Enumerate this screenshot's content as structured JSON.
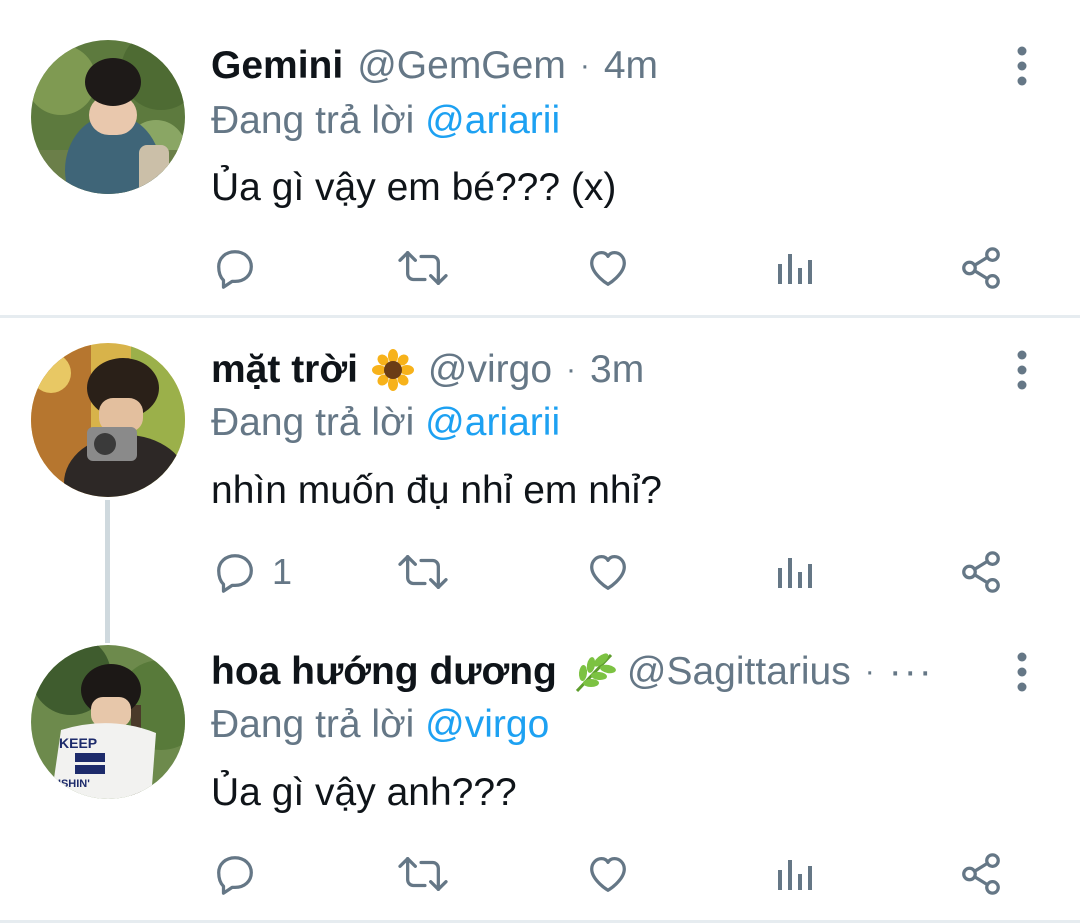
{
  "tweets": [
    {
      "name": "Gemini",
      "emoji": "",
      "handle": "@GemGem",
      "dot": "·",
      "time": "4m",
      "replying_prefix": "Đang trả lời ",
      "replying_to": "@ariarii",
      "text": "Ủa gì vậy em bé??? (x)",
      "reply_count": ""
    },
    {
      "name": "mặt trời",
      "emoji": "sunflower-emoji",
      "handle": "@virgo",
      "dot": "·",
      "time": "3m",
      "replying_prefix": "Đang trả lời ",
      "replying_to": "@ariarii",
      "text": "nhìn muốn đụ nhỉ em nhỉ?",
      "reply_count": "1"
    },
    {
      "name": "hoa hướng dương",
      "emoji": "herb-emoji",
      "handle": "@Sagittarius",
      "dot": "·",
      "time": "···",
      "replying_prefix": "Đang trả lời ",
      "replying_to": "@virgo",
      "text": "Ủa gì vậy anh???",
      "reply_count": ""
    }
  ],
  "colors": {
    "link": "#1da1f2",
    "muted": "#657786",
    "text": "#0f1419",
    "divider": "#e6ecf0"
  }
}
